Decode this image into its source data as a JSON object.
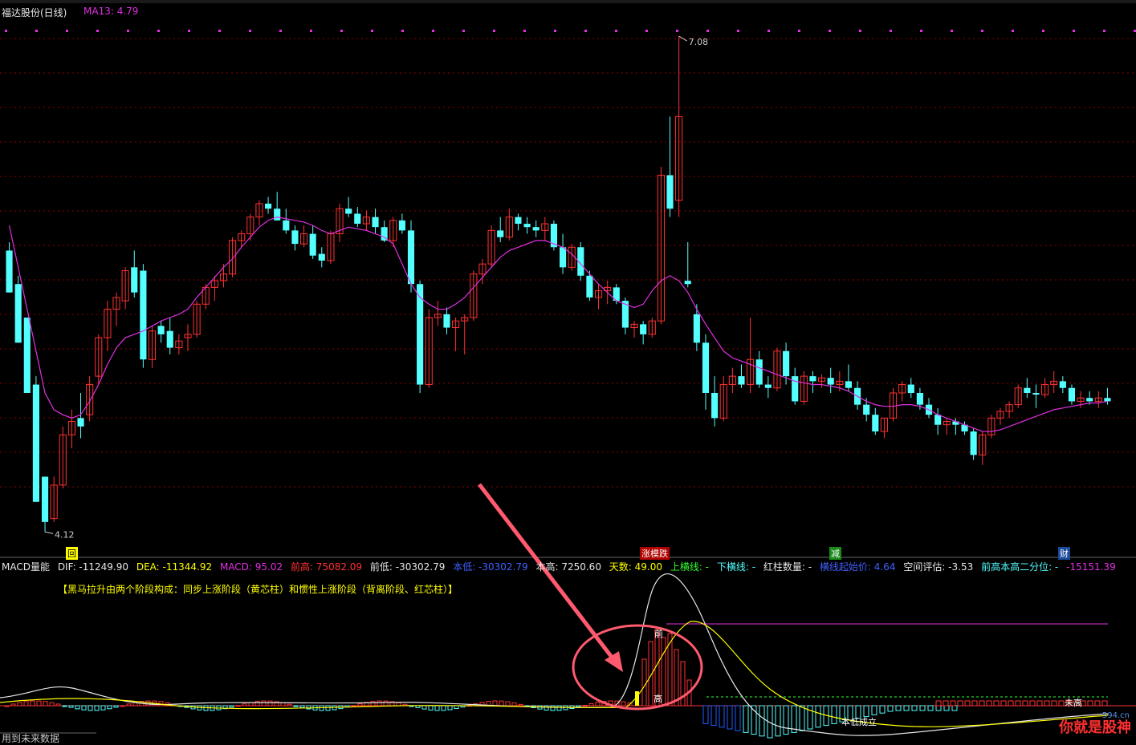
{
  "header": {
    "title": "福达股份(日线)",
    "ma_label": "MA13: 4.79"
  },
  "price_labels": {
    "high": "7.08",
    "low": "4.12"
  },
  "event_tags": {
    "tag1": "回",
    "tag2": "涨模跌",
    "tag3": "减",
    "tag4": "财"
  },
  "indicator": {
    "name": "MACD量能",
    "dif": "DIF: -11249.90",
    "dea": "DEA: -11344.92",
    "macd": "MACD: 95.02",
    "prev_high": "前高: 75082.09",
    "prev_low": "前低: -30302.79",
    "this_low": "本低: -30302.79",
    "this_high": "本高: 7250.60",
    "days": "天数: 49.00",
    "up_line": "上横线: -",
    "down_line": "下横线: -",
    "red_count": "红柱数量: -",
    "cross_start": "横线起始价: 4.64",
    "space_eval": "空间评估: -3.53",
    "quantile": "前高本高二分位: -",
    "last_val": "-15151.39",
    "note": "【黑马拉升由两个阶段构成：同步上涨阶段（黄芯柱）和惯性上涨阶段（背离阶段、红芯柱）】",
    "lbl_qian": "前",
    "lbl_gao": "高",
    "lbl_dilabel": "本低成立",
    "lbl_weigao": "未高"
  },
  "footer": {
    "text": "用到未来数据"
  },
  "watermark": {
    "text": "你就是股神",
    "site": "594.cn"
  },
  "colors": {
    "up": "#ff3232",
    "down": "#54ffff",
    "ma": "#e030e0",
    "grid": "#8b0000",
    "arrow": "#ff5a6e"
  },
  "chart_data": {
    "type": "candlestick",
    "title": "福达股份(日线)",
    "high_label": 7.08,
    "low_label": 4.12,
    "candles": [
      [
        5.8,
        5.85,
        5.55,
        5.55
      ],
      [
        5.6,
        5.65,
        5.25,
        5.25
      ],
      [
        5.4,
        5.4,
        4.95,
        4.95
      ],
      [
        5.0,
        5.05,
        4.3,
        4.3
      ],
      [
        4.45,
        4.45,
        4.12,
        4.18
      ],
      [
        4.2,
        4.45,
        4.18,
        4.4
      ],
      [
        4.4,
        4.75,
        4.38,
        4.7
      ],
      [
        4.7,
        4.85,
        4.62,
        4.78
      ],
      [
        4.8,
        4.95,
        4.68,
        4.75
      ],
      [
        4.82,
        5.05,
        4.78,
        5.0
      ],
      [
        5.05,
        5.3,
        5.0,
        5.28
      ],
      [
        5.28,
        5.5,
        5.2,
        5.45
      ],
      [
        5.45,
        5.55,
        5.35,
        5.52
      ],
      [
        5.5,
        5.7,
        5.45,
        5.68
      ],
      [
        5.7,
        5.8,
        5.52,
        5.55
      ],
      [
        5.68,
        5.72,
        5.1,
        5.15
      ],
      [
        5.15,
        5.35,
        5.1,
        5.32
      ],
      [
        5.35,
        5.38,
        5.25,
        5.3
      ],
      [
        5.32,
        5.4,
        5.18,
        5.22
      ],
      [
        5.22,
        5.3,
        5.18,
        5.26
      ],
      [
        5.28,
        5.36,
        5.2,
        5.3
      ],
      [
        5.3,
        5.5,
        5.28,
        5.48
      ],
      [
        5.48,
        5.6,
        5.45,
        5.58
      ],
      [
        5.58,
        5.65,
        5.5,
        5.62
      ],
      [
        5.62,
        5.72,
        5.58,
        5.66
      ],
      [
        5.66,
        5.88,
        5.64,
        5.86
      ],
      [
        5.86,
        5.92,
        5.82,
        5.9
      ],
      [
        5.9,
        6.02,
        5.86,
        6.0
      ],
      [
        6.0,
        6.1,
        5.95,
        6.08
      ],
      [
        6.08,
        6.12,
        6.02,
        6.05
      ],
      [
        6.05,
        6.15,
        6.0,
        5.98
      ],
      [
        5.98,
        6.05,
        5.9,
        5.92
      ],
      [
        5.92,
        5.95,
        5.8,
        5.84
      ],
      [
        5.84,
        5.95,
        5.82,
        5.9
      ],
      [
        5.9,
        5.95,
        5.75,
        5.77
      ],
      [
        5.78,
        5.82,
        5.7,
        5.74
      ],
      [
        5.74,
        5.92,
        5.72,
        5.9
      ],
      [
        5.9,
        6.08,
        5.85,
        6.05
      ],
      [
        6.05,
        6.12,
        6.0,
        6.02
      ],
      [
        6.02,
        6.06,
        5.94,
        5.96
      ],
      [
        5.96,
        6.04,
        5.92,
        6.0
      ],
      [
        6.0,
        6.05,
        5.9,
        5.94
      ],
      [
        5.94,
        5.98,
        5.85,
        5.86
      ],
      [
        5.86,
        6.0,
        5.82,
        5.98
      ],
      [
        5.98,
        6.02,
        5.9,
        5.92
      ],
      [
        5.92,
        5.98,
        5.55,
        5.6
      ],
      [
        5.6,
        5.62,
        4.95,
        5.0
      ],
      [
        5.0,
        5.45,
        4.98,
        5.4
      ],
      [
        5.4,
        5.5,
        5.35,
        5.42
      ],
      [
        5.42,
        5.46,
        5.3,
        5.34
      ],
      [
        5.34,
        5.4,
        5.2,
        5.38
      ],
      [
        5.38,
        5.42,
        5.18,
        5.4
      ],
      [
        5.4,
        5.68,
        5.38,
        5.66
      ],
      [
        5.66,
        5.75,
        5.6,
        5.72
      ],
      [
        5.72,
        5.95,
        5.7,
        5.92
      ],
      [
        5.92,
        6.0,
        5.85,
        5.88
      ],
      [
        5.88,
        6.05,
        5.86,
        6.0
      ],
      [
        6.0,
        6.02,
        5.92,
        5.96
      ],
      [
        5.96,
        6.0,
        5.9,
        5.94
      ],
      [
        5.94,
        5.98,
        5.88,
        5.92
      ],
      [
        5.92,
        6.0,
        5.86,
        5.96
      ],
      [
        5.96,
        5.98,
        5.8,
        5.82
      ],
      [
        5.82,
        5.9,
        5.66,
        5.7
      ],
      [
        5.7,
        5.84,
        5.68,
        5.82
      ],
      [
        5.82,
        5.85,
        5.62,
        5.65
      ],
      [
        5.65,
        5.68,
        5.5,
        5.52
      ],
      [
        5.52,
        5.6,
        5.45,
        5.56
      ],
      [
        5.56,
        5.62,
        5.48,
        5.58
      ],
      [
        5.58,
        5.6,
        5.48,
        5.5
      ],
      [
        5.5,
        5.52,
        5.3,
        5.34
      ],
      [
        5.34,
        5.38,
        5.28,
        5.36
      ],
      [
        5.36,
        5.38,
        5.24,
        5.3
      ],
      [
        5.3,
        5.4,
        5.28,
        5.38
      ],
      [
        5.38,
        6.3,
        5.36,
        6.25
      ],
      [
        6.25,
        6.6,
        6.0,
        6.05
      ],
      [
        6.1,
        7.08,
        6.0,
        6.6
      ],
      [
        5.62,
        5.85,
        5.58,
        5.6
      ],
      [
        5.42,
        5.48,
        5.2,
        5.25
      ],
      [
        5.25,
        5.3,
        4.85,
        4.95
      ],
      [
        4.95,
        5.05,
        4.75,
        4.8
      ],
      [
        4.8,
        5.05,
        4.78,
        5.0
      ],
      [
        5.0,
        5.1,
        4.95,
        5.05
      ],
      [
        5.05,
        5.12,
        4.98,
        5.0
      ],
      [
        5.0,
        5.4,
        4.95,
        5.15
      ],
      [
        5.15,
        5.2,
        4.98,
        5.0
      ],
      [
        5.0,
        5.05,
        4.92,
        4.98
      ],
      [
        4.98,
        5.22,
        4.96,
        5.2
      ],
      [
        5.2,
        5.25,
        5.0,
        5.05
      ],
      [
        5.05,
        5.1,
        4.88,
        4.9
      ],
      [
        4.9,
        5.08,
        4.88,
        5.05
      ],
      [
        5.05,
        5.08,
        4.95,
        5.02
      ],
      [
        5.02,
        5.06,
        4.98,
        5.04
      ],
      [
        5.04,
        5.1,
        4.95,
        5.0
      ],
      [
        5.0,
        5.08,
        4.96,
        5.02
      ],
      [
        5.02,
        5.12,
        4.96,
        4.98
      ],
      [
        4.98,
        5.02,
        4.85,
        4.88
      ],
      [
        4.88,
        4.92,
        4.78,
        4.82
      ],
      [
        4.82,
        4.86,
        4.7,
        4.72
      ],
      [
        4.72,
        4.8,
        4.68,
        4.8
      ],
      [
        4.8,
        4.98,
        4.78,
        4.95
      ],
      [
        4.95,
        5.02,
        4.9,
        5.0
      ],
      [
        5.0,
        5.04,
        4.92,
        4.95
      ],
      [
        4.95,
        4.98,
        4.85,
        4.88
      ],
      [
        4.88,
        4.92,
        4.8,
        4.82
      ],
      [
        4.82,
        4.86,
        4.7,
        4.76
      ],
      [
        4.76,
        4.8,
        4.7,
        4.78
      ],
      [
        4.78,
        4.8,
        4.7,
        4.76
      ],
      [
        4.76,
        4.78,
        4.7,
        4.72
      ],
      [
        4.72,
        4.74,
        4.55,
        4.58
      ],
      [
        4.58,
        4.72,
        4.52,
        4.7
      ],
      [
        4.7,
        4.82,
        4.68,
        4.8
      ],
      [
        4.8,
        4.86,
        4.76,
        4.84
      ],
      [
        4.84,
        4.9,
        4.8,
        4.88
      ],
      [
        4.88,
        5.0,
        4.86,
        4.98
      ],
      [
        4.98,
        5.04,
        4.92,
        4.95
      ],
      [
        4.95,
        5.0,
        4.86,
        4.94
      ],
      [
        4.94,
        5.04,
        4.92,
        5.0
      ],
      [
        5.0,
        5.08,
        4.95,
        5.02
      ],
      [
        5.02,
        5.05,
        4.95,
        4.98
      ],
      [
        4.98,
        5.0,
        4.88,
        4.9
      ],
      [
        4.9,
        4.96,
        4.86,
        4.92
      ],
      [
        4.92,
        4.96,
        4.88,
        4.9
      ],
      [
        4.9,
        4.96,
        4.86,
        4.92
      ],
      [
        4.92,
        4.98,
        4.88,
        4.9
      ]
    ],
    "ma13": [
      5.95,
      5.7,
      5.45,
      5.2,
      4.95,
      4.85,
      4.82,
      4.8,
      4.82,
      4.9,
      5.0,
      5.12,
      5.22,
      5.28,
      5.3,
      5.32,
      5.35,
      5.38,
      5.4,
      5.42,
      5.45,
      5.52,
      5.58,
      5.64,
      5.7,
      5.75,
      5.82,
      5.88,
      5.94,
      5.98,
      6.0,
      5.99,
      5.98,
      5.97,
      5.95,
      5.92,
      5.9,
      5.92,
      5.94,
      5.93,
      5.92,
      5.9,
      5.88,
      5.84,
      5.72,
      5.6,
      5.52,
      5.48,
      5.45,
      5.45,
      5.48,
      5.52,
      5.58,
      5.64,
      5.7,
      5.76,
      5.8,
      5.82,
      5.84,
      5.86,
      5.86,
      5.84,
      5.82,
      5.78,
      5.72,
      5.66,
      5.6,
      5.55,
      5.5,
      5.48,
      5.46,
      5.48,
      5.56,
      5.62,
      5.65,
      5.62,
      5.55,
      5.45,
      5.36,
      5.28,
      5.2,
      5.16,
      5.14,
      5.12,
      5.1,
      5.08,
      5.06,
      5.04,
      5.02,
      5.01,
      5.0,
      5.0,
      4.99,
      4.98,
      4.96,
      4.93,
      4.9,
      4.88,
      4.87,
      4.87,
      4.88,
      4.88,
      4.87,
      4.85,
      4.82,
      4.8,
      4.78,
      4.76,
      4.74,
      4.72,
      4.72,
      4.73,
      4.75,
      4.77,
      4.79,
      4.81,
      4.83,
      4.85,
      4.86,
      4.87,
      4.88,
      4.89,
      4.89,
      4.9
    ]
  }
}
